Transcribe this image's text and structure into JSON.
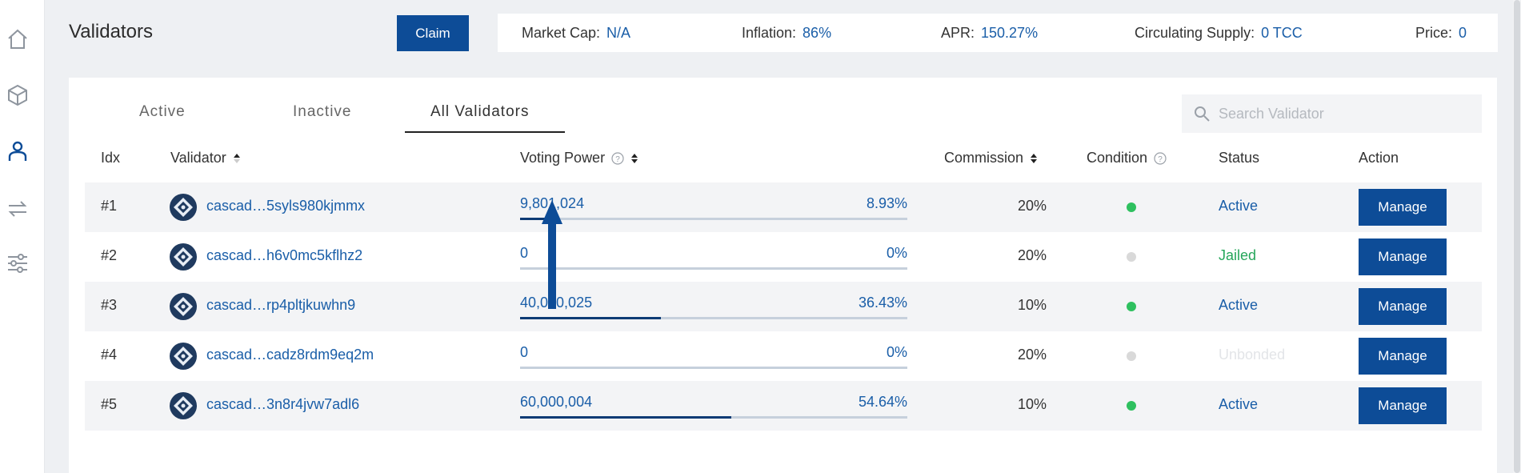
{
  "header": {
    "title": "Validators",
    "claim_label": "Claim"
  },
  "stats": [
    {
      "label": "Market Cap:",
      "value": "N/A"
    },
    {
      "label": "Inflation:",
      "value": "86%"
    },
    {
      "label": "APR:",
      "value": "150.27%"
    },
    {
      "label": "Circulating Supply:",
      "value": "0 TCC"
    },
    {
      "label": "Price:",
      "value": "0"
    }
  ],
  "tabs": [
    {
      "label": "Active"
    },
    {
      "label": "Inactive"
    },
    {
      "label": "All Validators",
      "active": true
    }
  ],
  "search": {
    "placeholder": "Search Validator",
    "value": ""
  },
  "columns": {
    "idx": "Idx",
    "validator": "Validator",
    "voting_power": "Voting Power",
    "commission": "Commission",
    "condition": "Condition",
    "status": "Status",
    "action": "Action"
  },
  "rows": [
    {
      "idx": "#1",
      "validator": "cascad…5syls980kjmmx",
      "voting_power": "9,801,024",
      "share": "8.93%",
      "share_fraction": 0.0893,
      "commission": "20%",
      "condition": "online",
      "status": "Active",
      "action": "Manage"
    },
    {
      "idx": "#2",
      "validator": "cascad…h6v0mc5kflhz2",
      "voting_power": "0",
      "share": "0%",
      "share_fraction": 0,
      "commission": "20%",
      "condition": "offline",
      "status": "Jailed",
      "action": "Manage"
    },
    {
      "idx": "#3",
      "validator": "cascad…rp4pltjkuwhn9",
      "voting_power": "40,000,025",
      "share": "36.43%",
      "share_fraction": 0.3643,
      "commission": "10%",
      "condition": "online",
      "status": "Active",
      "action": "Manage"
    },
    {
      "idx": "#4",
      "validator": "cascad…cadz8rdm9eq2m",
      "voting_power": "0",
      "share": "0%",
      "share_fraction": 0,
      "commission": "20%",
      "condition": "offline",
      "status": "Unbonded",
      "action": "Manage"
    },
    {
      "idx": "#5",
      "validator": "cascad…3n8r4jvw7adl6",
      "voting_power": "60,000,004",
      "share": "54.64%",
      "share_fraction": 0.5464,
      "commission": "10%",
      "condition": "online",
      "status": "Active",
      "action": "Manage"
    }
  ],
  "colors": {
    "accent": "#0d4c97",
    "link": "#1a5ea8",
    "online": "#2ec05f",
    "offline": "#d9d9d9",
    "status_active": "#1a5ea8",
    "status_jailed": "#26a65b",
    "status_unbonded": "#e3e5e8"
  },
  "icons": {
    "sidebar": [
      "home-icon",
      "cube-icon",
      "user-icon",
      "transfer-icon",
      "sliders-icon"
    ],
    "search": "search-icon",
    "help": "help-icon",
    "sort": "sort-icon",
    "avatar": "validator-avatar-icon",
    "annotation": "arrow-up-icon"
  }
}
